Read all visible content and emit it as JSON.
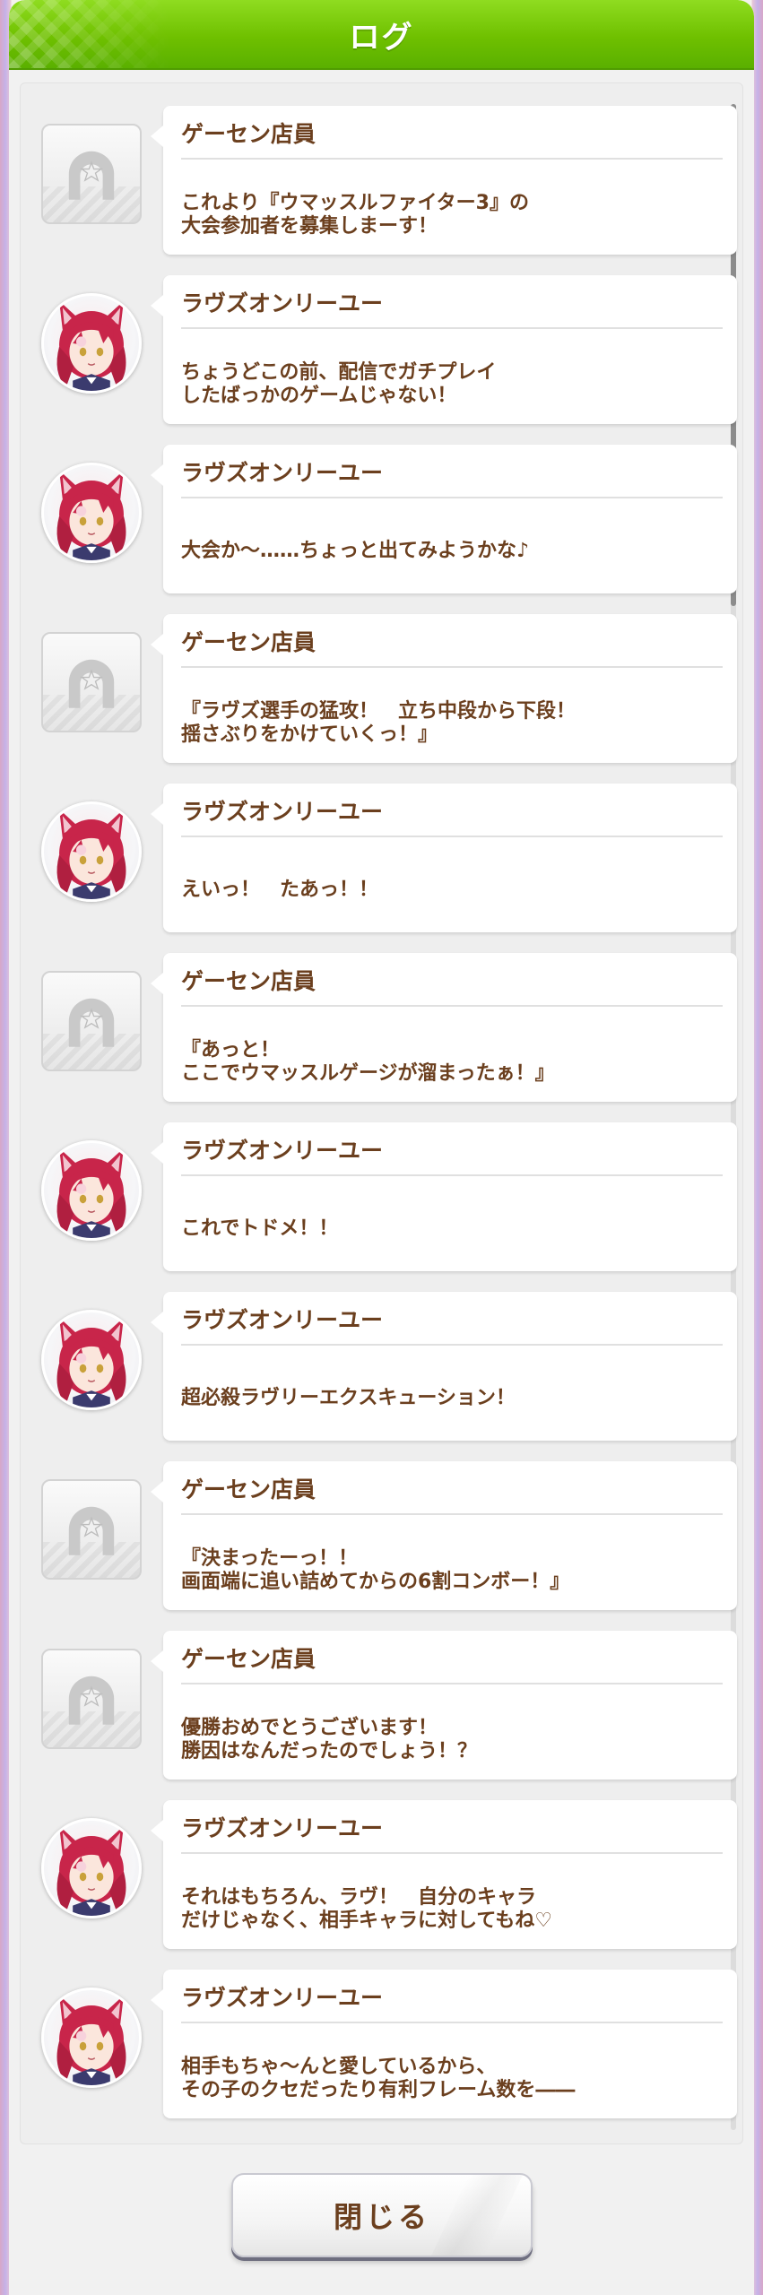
{
  "header": {
    "title": "ログ"
  },
  "colors": {
    "header_green": "#6fc000",
    "text_brown": "#6b3f1e",
    "character_hair": "#c8254a"
  },
  "entries": [
    {
      "speaker": "ゲーセン店員",
      "avatar": "horseshoe-placeholder-icon",
      "lines": [
        "これより『ウマッスルファイター3』の",
        "大会参加者を募集しまーす！"
      ]
    },
    {
      "speaker": "ラヴズオンリーユー",
      "avatar": "character-portrait",
      "lines": [
        "ちょうどこの前、配信でガチプレイ",
        "したばっかのゲームじゃない！"
      ]
    },
    {
      "speaker": "ラヴズオンリーユー",
      "avatar": "character-portrait",
      "lines": [
        "大会か～……ちょっと出てみようかな♪"
      ]
    },
    {
      "speaker": "ゲーセン店員",
      "avatar": "horseshoe-placeholder-icon",
      "lines": [
        "『ラヴズ選手の猛攻！　立ち中段から下段！",
        "揺さぶりをかけていくっ！』"
      ]
    },
    {
      "speaker": "ラヴズオンリーユー",
      "avatar": "character-portrait",
      "lines": [
        "えいっ！　たあっ！！"
      ]
    },
    {
      "speaker": "ゲーセン店員",
      "avatar": "horseshoe-placeholder-icon",
      "lines": [
        "『あっと！",
        "ここでウマッスルゲージが溜まったぁ！』"
      ]
    },
    {
      "speaker": "ラヴズオンリーユー",
      "avatar": "character-portrait",
      "lines": [
        "これでトドメ！！"
      ]
    },
    {
      "speaker": "ラヴズオンリーユー",
      "avatar": "character-portrait",
      "lines": [
        "超必殺ラヴリーエクスキューション！"
      ]
    },
    {
      "speaker": "ゲーセン店員",
      "avatar": "horseshoe-placeholder-icon",
      "lines": [
        "『決まったーっ！！",
        "画面端に追い詰めてからの6割コンボー！』"
      ]
    },
    {
      "speaker": "ゲーセン店員",
      "avatar": "horseshoe-placeholder-icon",
      "lines": [
        "優勝おめでとうございます！",
        "勝因はなんだったのでしょう！？"
      ]
    },
    {
      "speaker": "ラヴズオンリーユー",
      "avatar": "character-portrait",
      "lines": [
        "それはもちろん、ラヴ！　自分のキャラ",
        "だけじゃなく、相手キャラに対してもね♡"
      ]
    },
    {
      "speaker": "ラヴズオンリーユー",
      "avatar": "character-portrait",
      "lines": [
        "相手もちゃ～んと愛しているから、",
        "その子のクセだったり有利フレーム数を――"
      ]
    }
  ],
  "footer": {
    "close_label": "閉じる"
  }
}
